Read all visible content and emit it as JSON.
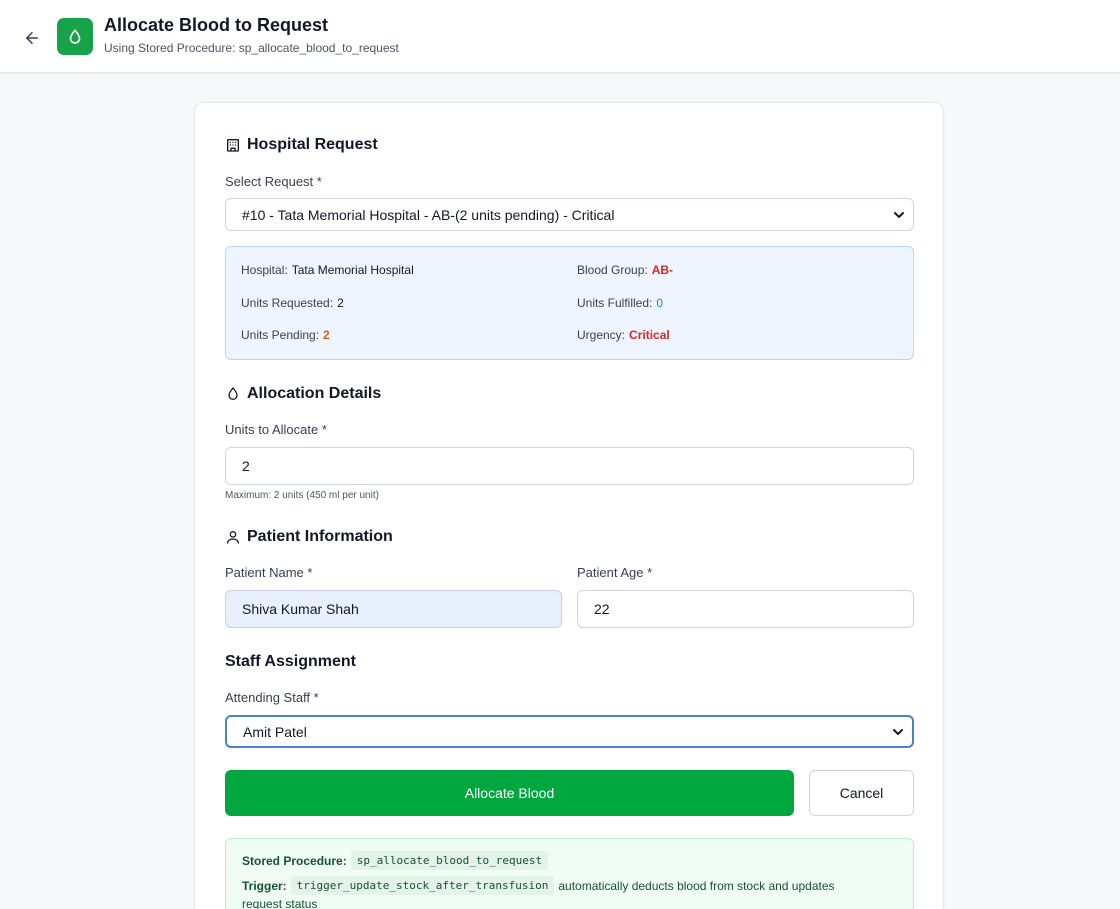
{
  "header": {
    "title": "Allocate Blood to Request",
    "subtitle": "Using Stored Procedure: sp_allocate_blood_to_request"
  },
  "hospital_request": {
    "section_title": "Hospital Request",
    "select_label": "Select Request *",
    "selected_value": "#10 - Tata Memorial Hospital - AB-(2 units pending) - Critical",
    "details": {
      "hospital_label": "Hospital:",
      "hospital_value": "Tata Memorial Hospital",
      "blood_group_label": "Blood Group:",
      "blood_group_value": "AB-",
      "units_requested_label": "Units Requested:",
      "units_requested_value": "2",
      "units_fulfilled_label": "Units Fulfilled:",
      "units_fulfilled_value": "0",
      "units_pending_label": "Units Pending:",
      "units_pending_value": "2",
      "urgency_label": "Urgency:",
      "urgency_value": "Critical"
    }
  },
  "allocation": {
    "section_title": "Allocation Details",
    "units_label": "Units to Allocate *",
    "units_value": "2",
    "hint": "Maximum: 2 units (450 ml per unit)"
  },
  "patient": {
    "section_title": "Patient Information",
    "name_label": "Patient Name *",
    "name_value": "Shiva Kumar Shah",
    "age_label": "Patient Age *",
    "age_value": "22"
  },
  "staff": {
    "section_title": "Staff Assignment",
    "attending_label": "Attending Staff *",
    "attending_value": "Amit Patel"
  },
  "actions": {
    "primary_label": "Allocate Blood",
    "cancel_label": "Cancel"
  },
  "procedure_info": {
    "stored_procedure_label": "Stored Procedure:",
    "stored_procedure_value": "sp_allocate_blood_to_request",
    "trigger_label": "Trigger:",
    "trigger_value": "trigger_update_stock_after_transfusion",
    "trigger_desc_1": "automatically deducts blood from stock and updates",
    "trigger_desc_2": "request status"
  },
  "colors": {
    "accent": "#00a63e",
    "critical": "#dc2626",
    "pending": "#ea580c",
    "fulfilled": "#16a34a"
  },
  "icons": [
    "arrow-left-icon",
    "blood-drop-icon",
    "hospital-icon",
    "user-icon",
    "chevron-down-icon"
  ]
}
